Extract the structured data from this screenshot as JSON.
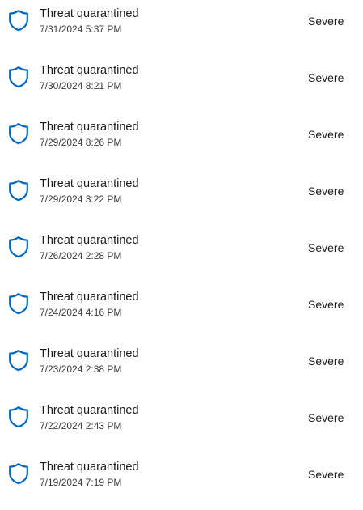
{
  "colors": {
    "accent": "#0067c0",
    "text": "#1b1b1b",
    "secondary_text": "#3a3a3a",
    "background": "#ffffff"
  },
  "icons": {
    "item_icon": "shield-icon"
  },
  "protection_history": {
    "items": [
      {
        "title": "Threat quarantined",
        "date": "7/31/2024 5:37 PM",
        "severity": "Severe"
      },
      {
        "title": "Threat quarantined",
        "date": "7/30/2024 8:21 PM",
        "severity": "Severe"
      },
      {
        "title": "Threat quarantined",
        "date": "7/29/2024 8:26 PM",
        "severity": "Severe"
      },
      {
        "title": "Threat quarantined",
        "date": "7/29/2024 3:22 PM",
        "severity": "Severe"
      },
      {
        "title": "Threat quarantined",
        "date": "7/26/2024 2:28 PM",
        "severity": "Severe"
      },
      {
        "title": "Threat quarantined",
        "date": "7/24/2024 4:16 PM",
        "severity": "Severe"
      },
      {
        "title": "Threat quarantined",
        "date": "7/23/2024 2:38 PM",
        "severity": "Severe"
      },
      {
        "title": "Threat quarantined",
        "date": "7/22/2024 2:43 PM",
        "severity": "Severe"
      },
      {
        "title": "Threat quarantined",
        "date": "7/19/2024 7:19 PM",
        "severity": "Severe"
      }
    ]
  }
}
